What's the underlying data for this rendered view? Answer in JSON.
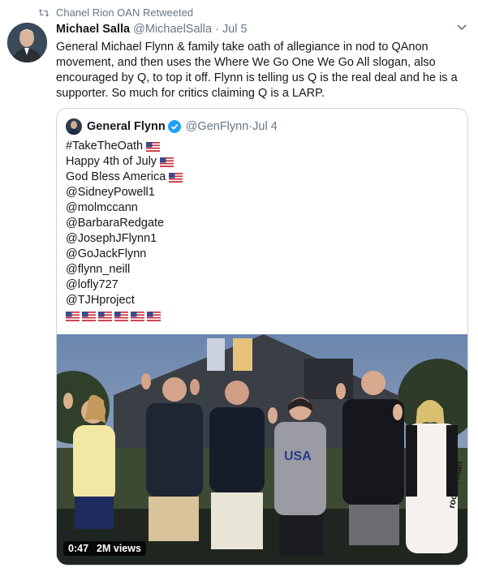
{
  "retweet": {
    "icon": "retweet-icon",
    "text": "Chanel Rion OAN Retweeted"
  },
  "tweet": {
    "author_name": "Michael Salla",
    "author_handle": "@MichaelSalla",
    "separator": "·",
    "date": "Jul 5",
    "text": "General Michael Flynn & family take oath of allegiance in nod to QAnon movement, and then uses the Where We Go One We Go All slogan, also encouraged by Q, to top it off. Flynn is telling us Q is the real deal and he is a supporter. So much for critics claiming Q is a LARP."
  },
  "quoted": {
    "author_name": "General Flynn",
    "author_handle": "@GenFlynn",
    "separator": "·",
    "date": "Jul 4",
    "lines": [
      {
        "text": "#TakeTheOath",
        "flag": true
      },
      {
        "text": "Happy 4th of July",
        "flag": true
      },
      {
        "text": "God Bless America",
        "flag": true
      },
      {
        "text": "@SidneyPowell1",
        "flag": false
      },
      {
        "text": "@molmccann",
        "flag": false
      },
      {
        "text": "@BarbaraRedgate",
        "flag": false
      },
      {
        "text": "@JosephJFlynn1",
        "flag": false
      },
      {
        "text": "@GoJackFlynn",
        "flag": false
      },
      {
        "text": "@flynn_neill",
        "flag": false
      },
      {
        "text": "@lofly727",
        "flag": false
      },
      {
        "text": "@TJHproject",
        "flag": false
      }
    ],
    "flag_count": 6,
    "video": {
      "duration": "0:47",
      "views": "2M views",
      "shirt_text_1": "USA",
      "shirt_text_2": "rocket man"
    }
  },
  "colors": {
    "secondary_text": "#657786",
    "verified_blue": "#1da1f2",
    "border": "#ccd6dd"
  }
}
